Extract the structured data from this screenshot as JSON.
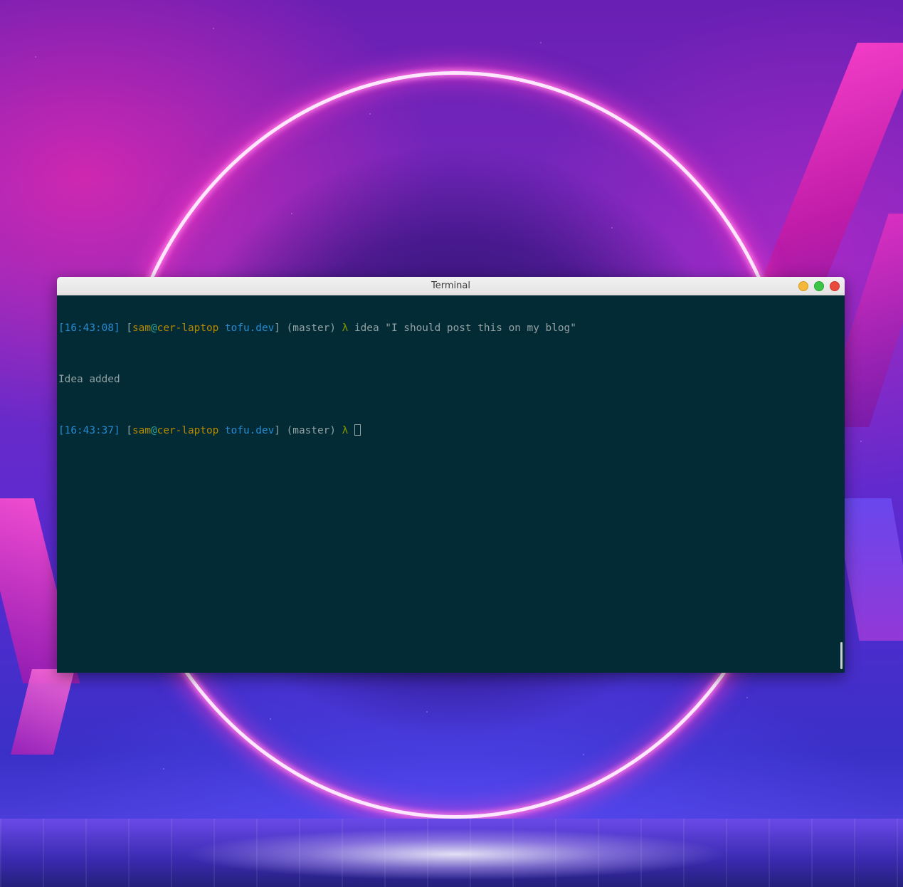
{
  "window": {
    "title": "Terminal"
  },
  "terminal": {
    "lines": [
      {
        "time": "16:43:08",
        "user": "sam",
        "at": "@",
        "host": "cer-laptop",
        "dir": "tofu.dev",
        "branch": "(master)",
        "prompt_symbol": "λ",
        "command": "idea \"I should post this on my blog\""
      },
      {
        "output": "Idea added"
      },
      {
        "time": "16:43:37",
        "user": "sam",
        "at": "@",
        "host": "cer-laptop",
        "dir": "tofu.dev",
        "branch": "(master)",
        "prompt_symbol": "λ",
        "command": ""
      }
    ]
  },
  "colors": {
    "terminal_bg": "#032b36",
    "time": "#268bd2",
    "user": "#b58900",
    "at": "#2aa198",
    "dir": "#268bd2",
    "text": "#93a1a1",
    "lambda": "#859900",
    "minimize": "#f4b83a",
    "maximize": "#3cc446",
    "close": "#ea4a3e"
  },
  "icons": [
    "minimize-icon",
    "maximize-icon",
    "close-icon"
  ]
}
